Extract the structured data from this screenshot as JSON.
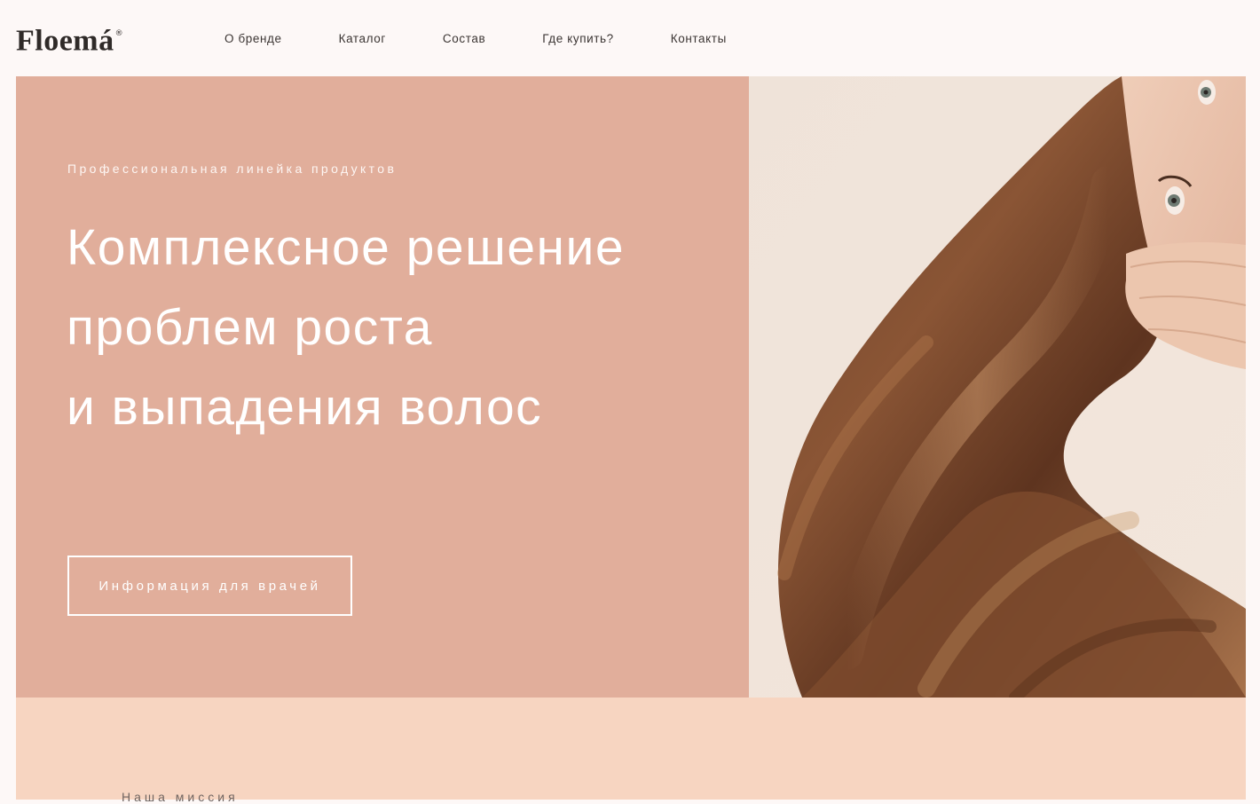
{
  "brand": {
    "logo": "Floemá",
    "registered_mark": "®"
  },
  "nav": {
    "items": [
      {
        "label": "О бренде"
      },
      {
        "label": "Каталог"
      },
      {
        "label": "Состав"
      },
      {
        "label": "Где купить?"
      },
      {
        "label": "Контакты"
      }
    ]
  },
  "hero": {
    "eyebrow": "Профессиональная линейка продуктов",
    "headline_lines": [
      "Комплексное решение",
      "проблем роста",
      "и выпадения волос"
    ],
    "cta_label": "Информация для врачей"
  },
  "mission": {
    "label": "Наша миссия"
  },
  "colors": {
    "page_bg": "#fdf8f7",
    "hero_panel": "#e1ae9b",
    "mission_bg": "#f7d5c1",
    "text_dark": "#3b3533",
    "hair_brown": "#7a4a2e"
  }
}
